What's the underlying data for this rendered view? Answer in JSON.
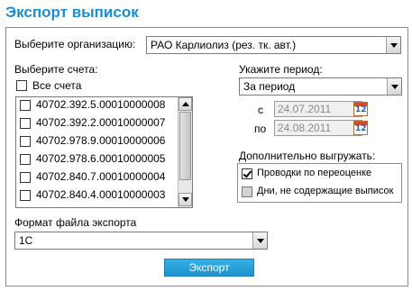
{
  "title": "Экспорт выписок",
  "org": {
    "label": "Выберите организацию:",
    "value": "РАО Карлиолиз (рез. тк. авт.)"
  },
  "accounts": {
    "label": "Выберите счета:",
    "all_label": "Все счета",
    "all_checked": false,
    "items": [
      {
        "number": "40702.392.5.00010000008",
        "checked": false
      },
      {
        "number": "40702.392.2.00010000007",
        "checked": false
      },
      {
        "number": "40702.978.9.00010000006",
        "checked": false
      },
      {
        "number": "40702.978.6.00010000005",
        "checked": false
      },
      {
        "number": "40702.840.7.00010000004",
        "checked": false
      },
      {
        "number": "40702.840.4.00010000003",
        "checked": false
      }
    ]
  },
  "period": {
    "label": "Укажите период:",
    "value": "За период",
    "from_label": "с",
    "from_value": "24.07.2011",
    "to_label": "по",
    "to_value": "24.08.2011",
    "calendar_day": "12"
  },
  "extra": {
    "label": "Дополнительно выгружать:",
    "options": [
      {
        "label": "Проводки по переоценке",
        "checked": true
      },
      {
        "label": "Дни, не содержащие выписок",
        "checked": false,
        "disabled": true
      }
    ]
  },
  "format": {
    "label": "Формат файла экспорта",
    "value": "1С"
  },
  "export_button": "Экспорт",
  "colors": {
    "accent": "#1a8fd0",
    "button": "#2aa3dc"
  }
}
